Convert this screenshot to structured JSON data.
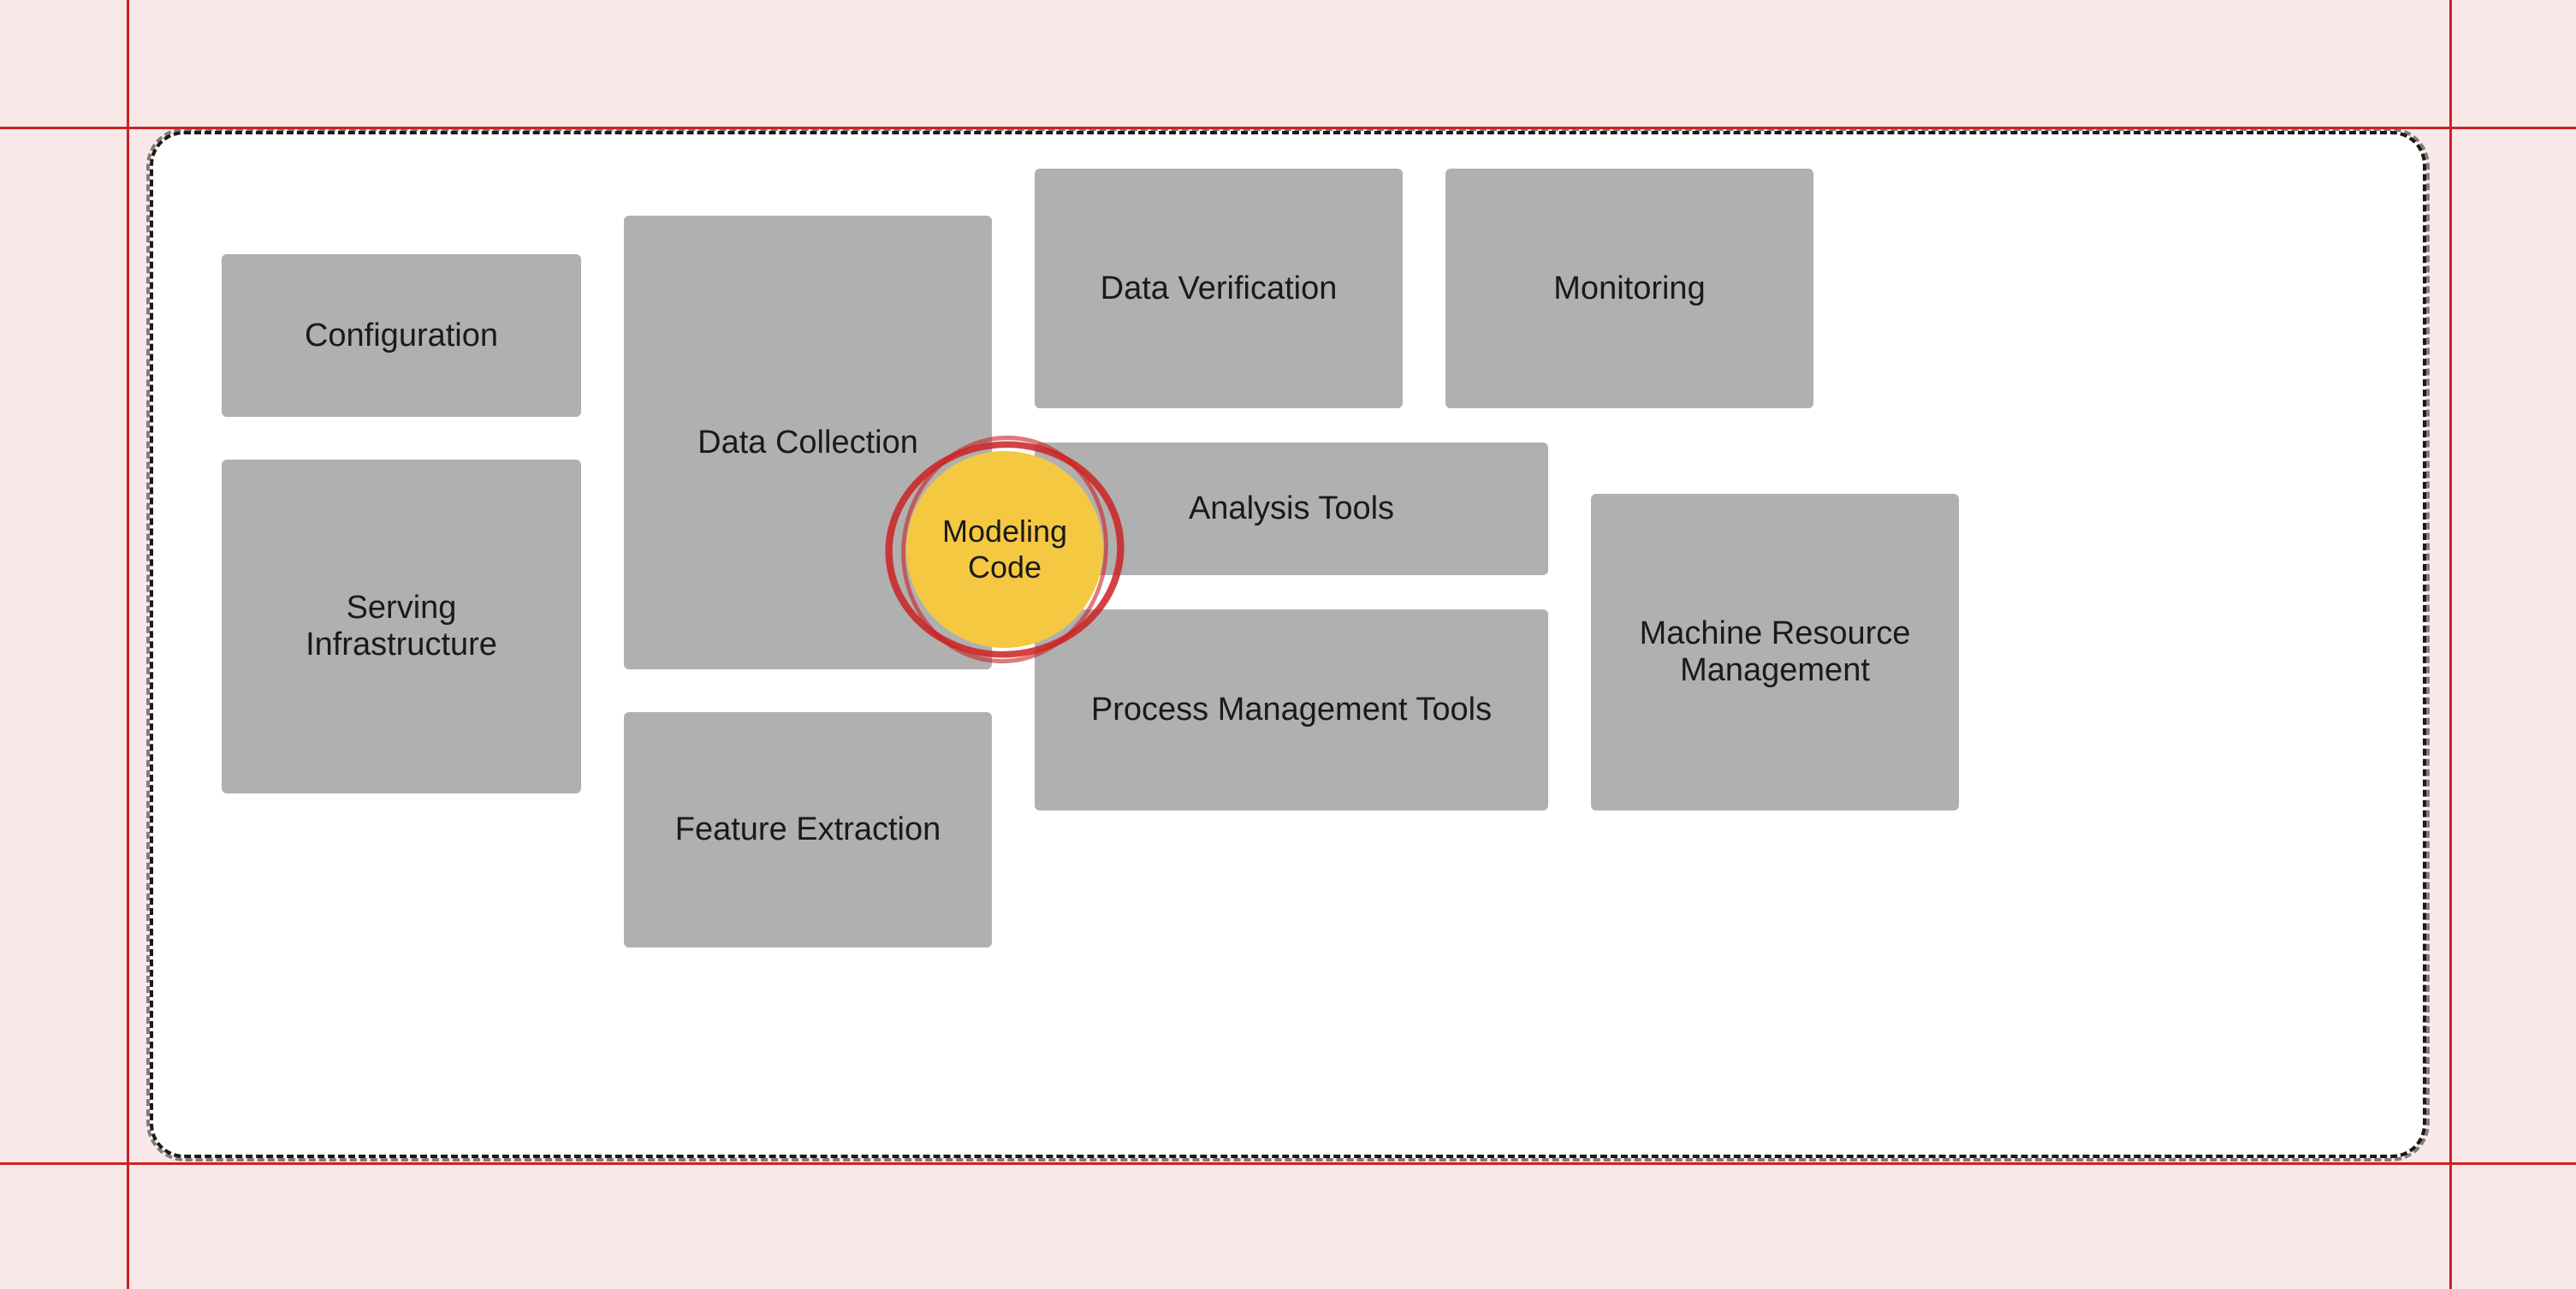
{
  "background_color": "#f9e8e8",
  "grid_lines": {
    "horizontal": [
      150,
      1356
    ],
    "vertical": [
      150,
      2860
    ]
  },
  "main_container": {
    "border_color": "#1a1a1a",
    "background": "#ffffff"
  },
  "boxes": {
    "configuration": {
      "label": "Configuration"
    },
    "serving_infrastructure": {
      "label": "Serving\nInfrastructure"
    },
    "data_collection": {
      "label": "Data Collection"
    },
    "data_verification": {
      "label": "Data Verification"
    },
    "monitoring": {
      "label": "Monitoring"
    },
    "analysis_tools": {
      "label": "Analysis Tools"
    },
    "process_management": {
      "label": "Process Management Tools"
    },
    "machine_resource": {
      "label": "Machine Resource\nManagement"
    },
    "feature_extraction": {
      "label": "Feature Extraction"
    }
  },
  "modeling_code": {
    "label": "Modeling\nCode",
    "background": "#f5c842",
    "ring_color": "#cc2222"
  }
}
